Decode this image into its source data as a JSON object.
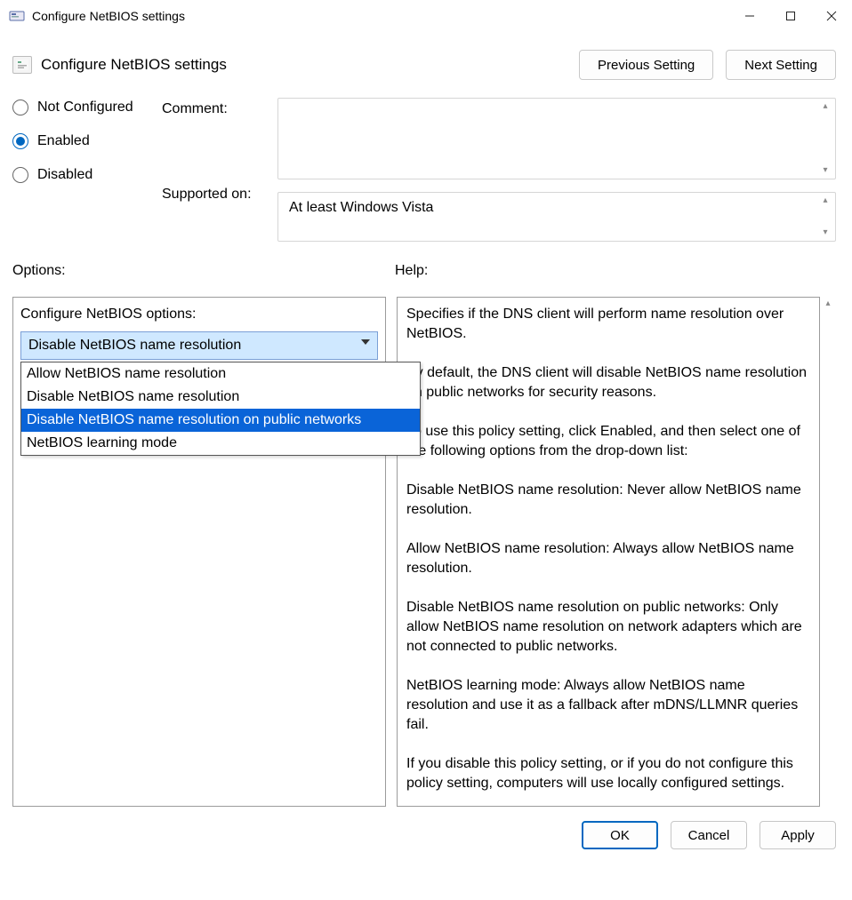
{
  "window": {
    "title": "Configure NetBIOS settings"
  },
  "header": {
    "title": "Configure NetBIOS settings",
    "prev_btn": "Previous Setting",
    "next_btn": "Next Setting"
  },
  "state": {
    "options": [
      "Not Configured",
      "Enabled",
      "Disabled"
    ],
    "selected_index": 1,
    "comment_label": "Comment:",
    "supported_label": "Supported on:",
    "supported_value": "At least Windows Vista"
  },
  "sections": {
    "options_label": "Options:",
    "help_label": "Help:"
  },
  "options_panel": {
    "title": "Configure NetBIOS options:",
    "combo_value": "Disable NetBIOS name resolution",
    "dropdown": {
      "items": [
        "Allow NetBIOS name resolution",
        "Disable NetBIOS name resolution",
        "Disable NetBIOS name resolution on public networks",
        "NetBIOS learning mode"
      ],
      "highlighted_index": 2
    }
  },
  "help_text": "Specifies if the DNS client will perform name resolution over NetBIOS.\n\nBy default, the DNS client will disable NetBIOS name resolution on public networks for security reasons.\n\nTo use this policy setting, click Enabled, and then select one of the following options from the drop-down list:\n\nDisable NetBIOS name resolution: Never allow NetBIOS name resolution.\n\nAllow NetBIOS name resolution: Always allow NetBIOS name resolution.\n\nDisable NetBIOS name resolution on public networks: Only allow NetBIOS name resolution on network adapters which are not connected to public networks.\n\nNetBIOS learning mode: Always allow NetBIOS name resolution and use it as a fallback after mDNS/LLMNR queries fail.\n\nIf you disable this policy setting, or if you do not configure this policy setting, computers will use locally configured settings.",
  "footer": {
    "ok": "OK",
    "cancel": "Cancel",
    "apply": "Apply"
  }
}
